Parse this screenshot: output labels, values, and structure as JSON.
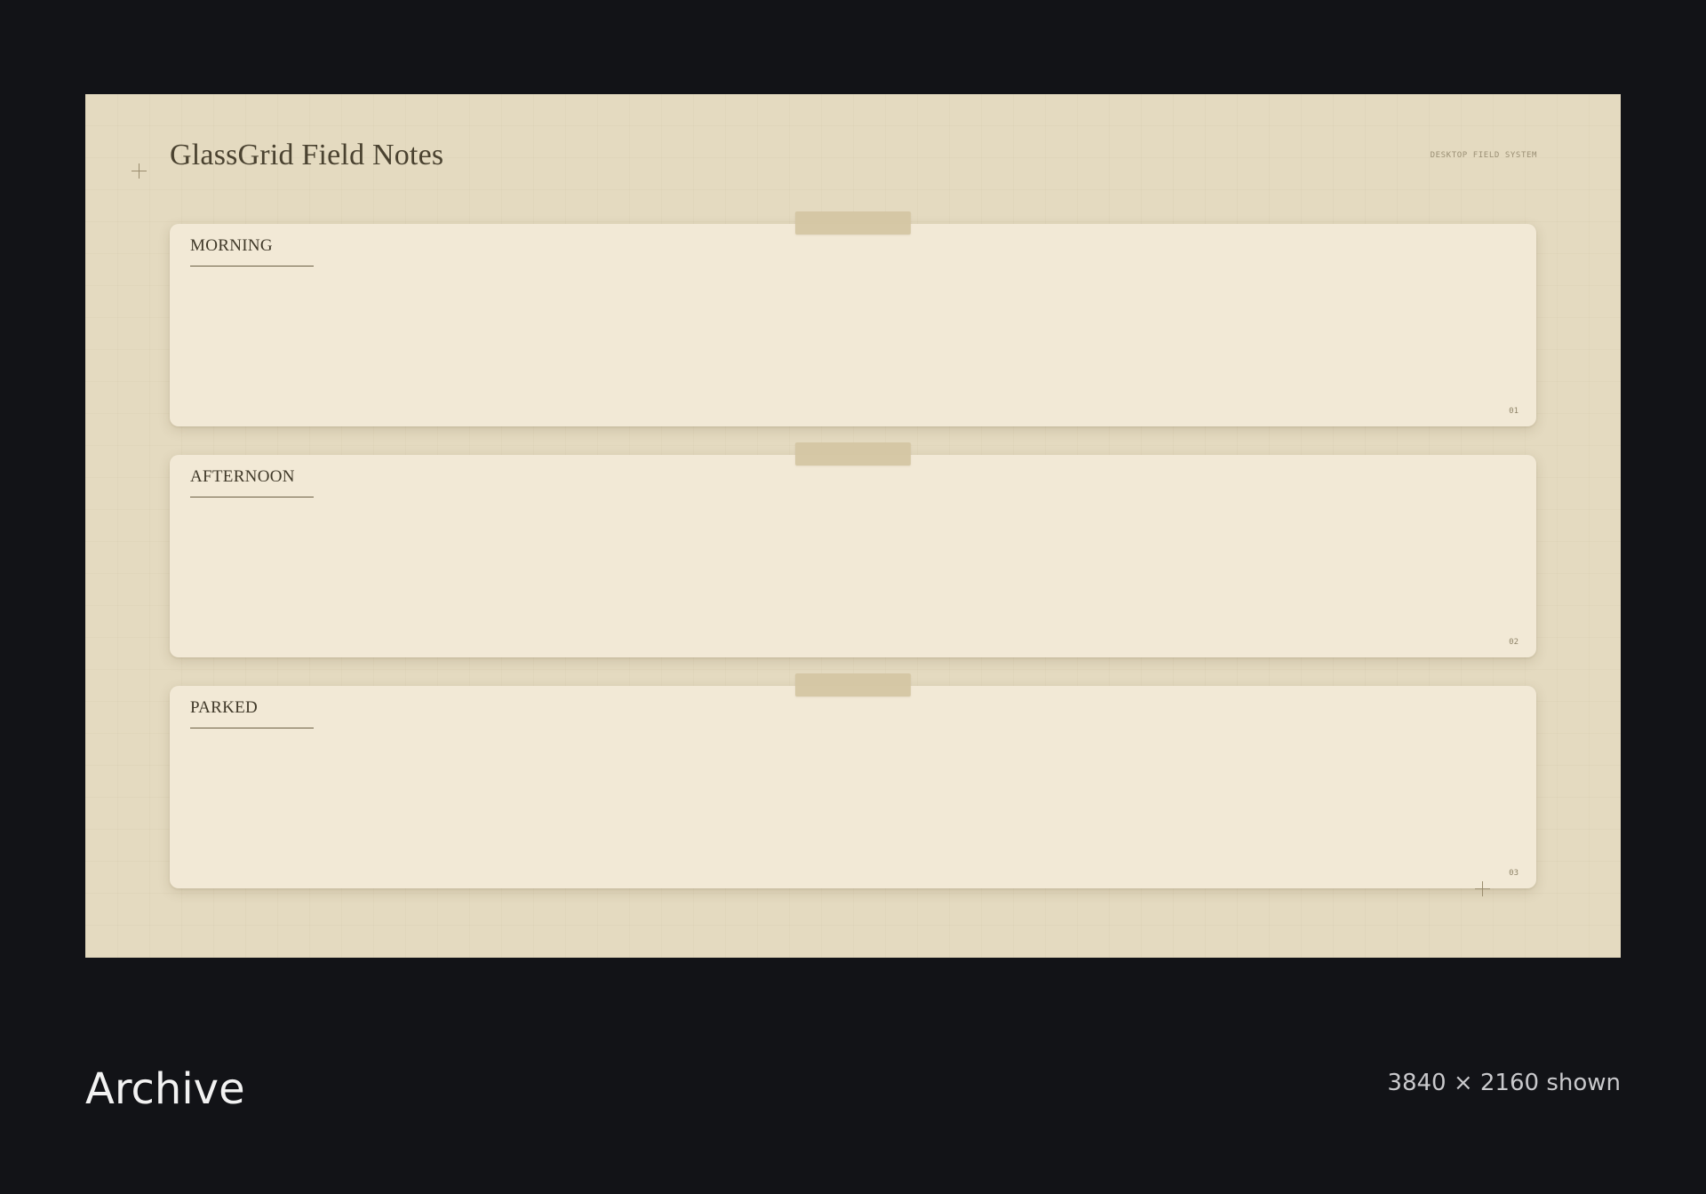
{
  "page": {
    "title": "GlassGrid Field Notes",
    "system_label": "DESKTOP FIELD SYSTEM"
  },
  "cards": [
    {
      "title": "MORNING",
      "number": "01"
    },
    {
      "title": "AFTERNOON",
      "number": "02"
    },
    {
      "title": "PARKED",
      "number": "03"
    }
  ],
  "footer": {
    "label": "Archive",
    "resolution": "3840 × 2160 shown"
  },
  "colors": {
    "background": "#121317",
    "paper": "#e4dac0",
    "card": "#f2e9d6",
    "tape": "#d5c7a4",
    "ink": "#3f3828"
  }
}
